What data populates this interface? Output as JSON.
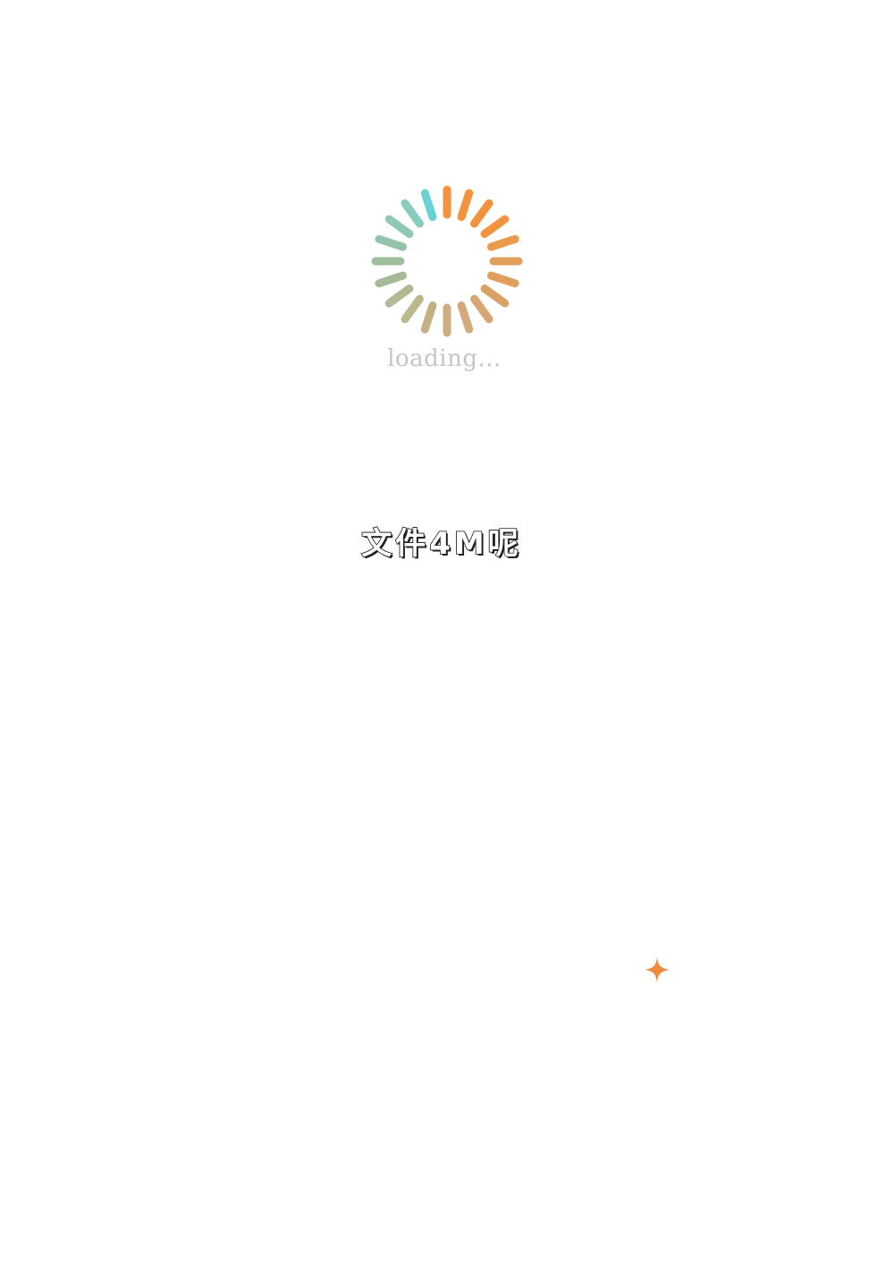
{
  "loader": {
    "label": "loading...",
    "label_color": "#c8c3c6",
    "spoke_count": 20,
    "spoke_colors": [
      "#f6913f",
      "#f5923e",
      "#f4913d",
      "#f2943f",
      "#eb9a4a",
      "#e09f5a",
      "#e29e5c",
      "#d9a366",
      "#d7a672",
      "#d4aa7c",
      "#cead81",
      "#c4b084",
      "#bbb88c",
      "#b1b992",
      "#a5bb97",
      "#9ebf9c",
      "#95c3a6",
      "#8fc8b3",
      "#86cdc0",
      "#67d1d6"
    ]
  },
  "caption": {
    "text": "文件4M呢"
  },
  "sparkle": {
    "icon": "sparkle-icon",
    "color": "#f08a3a"
  }
}
